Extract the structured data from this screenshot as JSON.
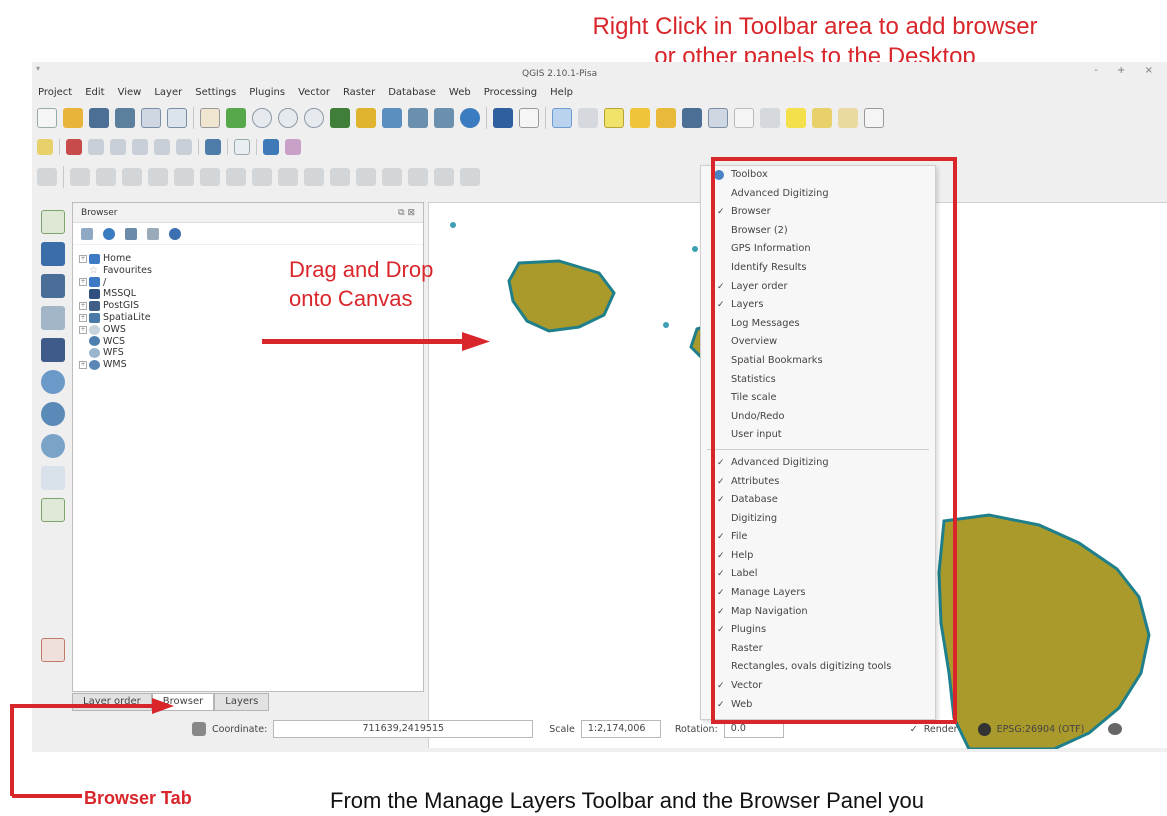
{
  "annotation": {
    "title_lines": [
      "Right Click in Toolbar area to add browser",
      "or other panels to the Desktop"
    ],
    "drag_lines": [
      "Drag and Drop",
      "onto Canvas"
    ],
    "browser_tab_label": "Browser Tab",
    "bottom_text": "From the Manage Layers Toolbar and the Browser Panel you",
    "color": "#d8262b"
  },
  "window": {
    "title": "QGIS 2.10.1-Pisa",
    "controls": "- + ×"
  },
  "menu": [
    "Project",
    "Edit",
    "View",
    "Layer",
    "Settings",
    "Plugins",
    "Vector",
    "Raster",
    "Database",
    "Web",
    "Processing",
    "Help"
  ],
  "browser_panel": {
    "title": "Browser",
    "controls": "⧉ ⊠",
    "items": [
      {
        "label": "Home",
        "expandable": true,
        "icon": "folder-icon"
      },
      {
        "label": "Favourites",
        "expandable": false,
        "icon": "star-icon"
      },
      {
        "label": "/",
        "expandable": true,
        "icon": "folder-icon"
      },
      {
        "label": "MSSQL",
        "expandable": false,
        "icon": "mssql-icon"
      },
      {
        "label": "PostGIS",
        "expandable": true,
        "icon": "postgis-icon"
      },
      {
        "label": "SpatiaLite",
        "expandable": true,
        "icon": "spatialite-icon"
      },
      {
        "label": "OWS",
        "expandable": true,
        "icon": "ows-icon"
      },
      {
        "label": "WCS",
        "expandable": false,
        "icon": "wcs-icon"
      },
      {
        "label": "WFS",
        "expandable": false,
        "icon": "wfs-icon"
      },
      {
        "label": "WMS",
        "expandable": true,
        "icon": "wms-icon"
      }
    ]
  },
  "tabs": [
    {
      "label": "Layer order",
      "active": false
    },
    {
      "label": "Browser",
      "active": true
    },
    {
      "label": "Layers",
      "active": false
    }
  ],
  "statusbar": {
    "coordinate_label": "Coordinate:",
    "coordinate_value": "711639,2419515",
    "scale_label": "Scale",
    "scale_value": "1:2,174,006",
    "rotation_label": "Rotation:",
    "rotation_value": "0.0",
    "render_label": "Render",
    "crs": "EPSG:26904 (OTF)"
  },
  "context_menu": {
    "panels": [
      {
        "label": "Toolbox",
        "checked": false,
        "icon": true
      },
      {
        "label": "Advanced Digitizing",
        "checked": false
      },
      {
        "label": "Browser",
        "checked": true
      },
      {
        "label": "Browser (2)",
        "checked": false
      },
      {
        "label": "GPS Information",
        "checked": false
      },
      {
        "label": "Identify Results",
        "checked": false
      },
      {
        "label": "Layer order",
        "checked": true
      },
      {
        "label": "Layers",
        "checked": true
      },
      {
        "label": "Log Messages",
        "checked": false
      },
      {
        "label": "Overview",
        "checked": false
      },
      {
        "label": "Spatial Bookmarks",
        "checked": false
      },
      {
        "label": "Statistics",
        "checked": false
      },
      {
        "label": "Tile scale",
        "checked": false
      },
      {
        "label": "Undo/Redo",
        "checked": false
      },
      {
        "label": "User input",
        "checked": false
      }
    ],
    "toolbars": [
      {
        "label": "Advanced Digitizing",
        "checked": true
      },
      {
        "label": "Attributes",
        "checked": true
      },
      {
        "label": "Database",
        "checked": true
      },
      {
        "label": "Digitizing",
        "checked": false
      },
      {
        "label": "File",
        "checked": true
      },
      {
        "label": "Help",
        "checked": true
      },
      {
        "label": "Label",
        "checked": true
      },
      {
        "label": "Manage Layers",
        "checked": true
      },
      {
        "label": "Map Navigation",
        "checked": true
      },
      {
        "label": "Plugins",
        "checked": true
      },
      {
        "label": "Raster",
        "checked": false
      },
      {
        "label": "Rectangles, ovals digitizing tools",
        "checked": false
      },
      {
        "label": "Vector",
        "checked": true
      },
      {
        "label": "Web",
        "checked": true
      }
    ]
  },
  "colors": {
    "island_fill": "#aa9a2c",
    "island_outline": "#1f7f8a",
    "point": "#3c9fb5"
  }
}
